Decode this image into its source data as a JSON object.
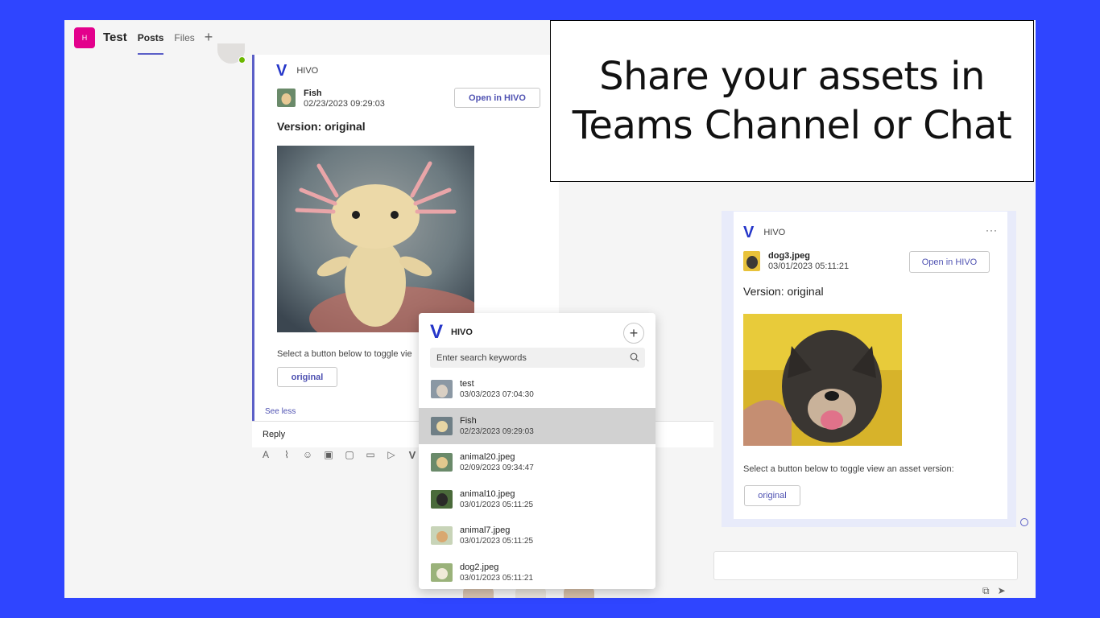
{
  "teams": {
    "avatar_initial": "H",
    "team_name": "Test",
    "tabs": [
      {
        "label": "Posts",
        "active": true
      },
      {
        "label": "Files",
        "active": false
      }
    ],
    "add_tab_icon": "plus-icon"
  },
  "post_card": {
    "app_name": "HIVO",
    "asset_name": "Fish",
    "asset_date": "02/23/2023 09:29:03",
    "open_button": "Open in HIVO",
    "version_label": "Version: original",
    "toggle_text": "Select a button below to toggle vie",
    "version_button": "original",
    "see_less": "See less"
  },
  "reply": {
    "label": "Reply"
  },
  "headline": {
    "line1": "Share your assets in",
    "line2": "Teams Channel or Chat"
  },
  "right_card": {
    "app_name": "HIVO",
    "more_icon": "···",
    "asset_name": "dog3.jpeg",
    "asset_date": "03/01/2023 05:11:21",
    "open_button": "Open in HIVO",
    "version_label": "Version: original",
    "toggle_text": "Select a button below to toggle view an asset version:",
    "version_button": "original"
  },
  "popup": {
    "title": "HIVO",
    "search_placeholder": "Enter search keywords",
    "items": [
      {
        "name": "test",
        "date": "03/03/2023 07:04:30",
        "selected": false
      },
      {
        "name": "Fish",
        "date": "02/23/2023 09:29:03",
        "selected": true
      },
      {
        "name": "animal20.jpeg",
        "date": "02/09/2023 09:34:47",
        "selected": false
      },
      {
        "name": "animal10.jpeg",
        "date": "03/01/2023 05:11:25",
        "selected": false
      },
      {
        "name": "animal7.jpeg",
        "date": "03/01/2023 05:11:25",
        "selected": false
      },
      {
        "name": "dog2.jpeg",
        "date": "03/01/2023 05:11:21",
        "selected": false
      }
    ]
  },
  "colors": {
    "background": "#2f45ff",
    "accent": "#5b5fc7",
    "team_avatar": "#e3008c",
    "hivo_brand": "#2536c9"
  }
}
